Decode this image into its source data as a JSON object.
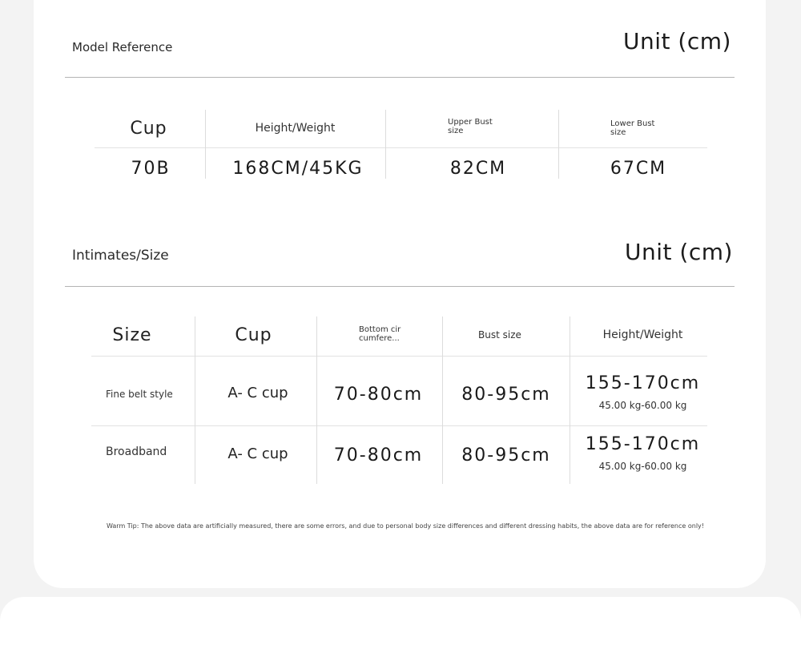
{
  "model_section": {
    "title": "Model Reference",
    "unit": "Unit (cm)",
    "headers": [
      "Cup",
      "Height/Weight",
      "Upper Bust size",
      "Lower Bust size"
    ],
    "row": [
      "70B",
      "168CM/45KG",
      "82CM",
      "67CM"
    ]
  },
  "size_section": {
    "title": "Intimates/Size",
    "unit": "Unit (cm)",
    "headers": [
      "Size",
      "Cup",
      "Bottom cir cumfere...",
      "Bust size",
      "Height/Weight"
    ],
    "rows": [
      {
        "size": "Fine belt style",
        "cup": "A- C cup",
        "bottom": "70-80cm",
        "bust": "80-95cm",
        "height": "155-170cm",
        "weight": "45.00 kg-60.00 kg"
      },
      {
        "size": "Broadband",
        "cup": "A- C cup",
        "bottom": "70-80cm",
        "bust": "80-95cm",
        "height": "155-170cm",
        "weight": "45.00 kg-60.00 kg"
      }
    ]
  },
  "tip": "Warm Tip: The above data are artificially measured, there are some errors, and due to personal body size differences and different dressing habits, the above data are for reference only!"
}
